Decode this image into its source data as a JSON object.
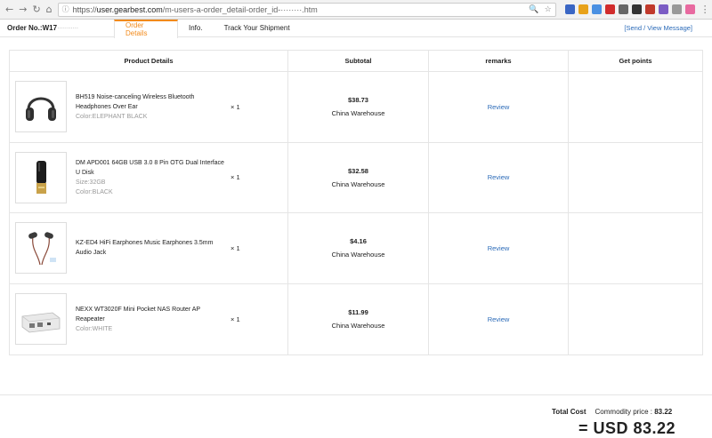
{
  "browser": {
    "url_scheme": "https://",
    "url_host": "user.gearbest.com",
    "url_path": "/m-users-a-order_detail-order_id-········.htm",
    "extensions": [
      {
        "name": "ext-1",
        "color": "#3a66c4"
      },
      {
        "name": "ext-2",
        "color": "#e8a21a"
      },
      {
        "name": "ext-3",
        "color": "#4a90e2"
      },
      {
        "name": "ext-4",
        "color": "#d12c2c"
      },
      {
        "name": "ext-5",
        "color": "#666666"
      },
      {
        "name": "ext-6",
        "color": "#333333"
      },
      {
        "name": "ext-7",
        "color": "#c0392b"
      },
      {
        "name": "ext-8",
        "color": "#7b5cc4"
      },
      {
        "name": "ext-9",
        "color": "#999999"
      },
      {
        "name": "ext-10",
        "color": "#e86aa0"
      }
    ]
  },
  "order": {
    "label": "Order No.:",
    "number_visible": "W17",
    "number_obscured": "···········"
  },
  "tabs": [
    {
      "label": "Order Details",
      "active": true
    },
    {
      "label": "Info.",
      "active": false
    },
    {
      "label": "Track Your Shipment",
      "active": false
    }
  ],
  "send_view_message": "[Send / View Message]",
  "table": {
    "headers": [
      "Product Details",
      "Subtotal",
      "remarks",
      "Get points"
    ],
    "rows": [
      {
        "name": "BH519 Noise-canceling Wireless Bluetooth Headphones Over Ear",
        "attr": "Color:ELEPHANT BLACK",
        "qty": "× 1",
        "price": "$38.73",
        "warehouse": "China Warehouse",
        "remark": "Review",
        "image": "headphones"
      },
      {
        "name": "DM APD001 64GB USB 3.0 8 Pin OTG Dual Interface U Disk",
        "attr": "Size:32GB",
        "attr2": "Color:BLACK",
        "qty": "× 1",
        "price": "$32.58",
        "warehouse": "China Warehouse",
        "remark": "Review",
        "image": "usb-drive"
      },
      {
        "name": "KZ-ED4 HiFi Earphones Music Earphones 3.5mm Audio Jack",
        "attr": "",
        "qty": "× 1",
        "price": "$4.16",
        "warehouse": "China Warehouse",
        "remark": "Review",
        "image": "earphones"
      },
      {
        "name": "NEXX WT3020F Mini Pocket NAS Router AP Reapeater",
        "attr": "Color:WHITE",
        "qty": "× 1",
        "price": "$11.99",
        "warehouse": "China Warehouse",
        "remark": "Review",
        "image": "router"
      }
    ]
  },
  "totals": {
    "total_cost_label": "Total Cost",
    "commodity_label": "Commodity price :",
    "commodity_value": "83.22",
    "grand_total": "= USD 83.22"
  },
  "colors": {
    "accent": "#f28a1b",
    "link": "#2a6ab8"
  }
}
